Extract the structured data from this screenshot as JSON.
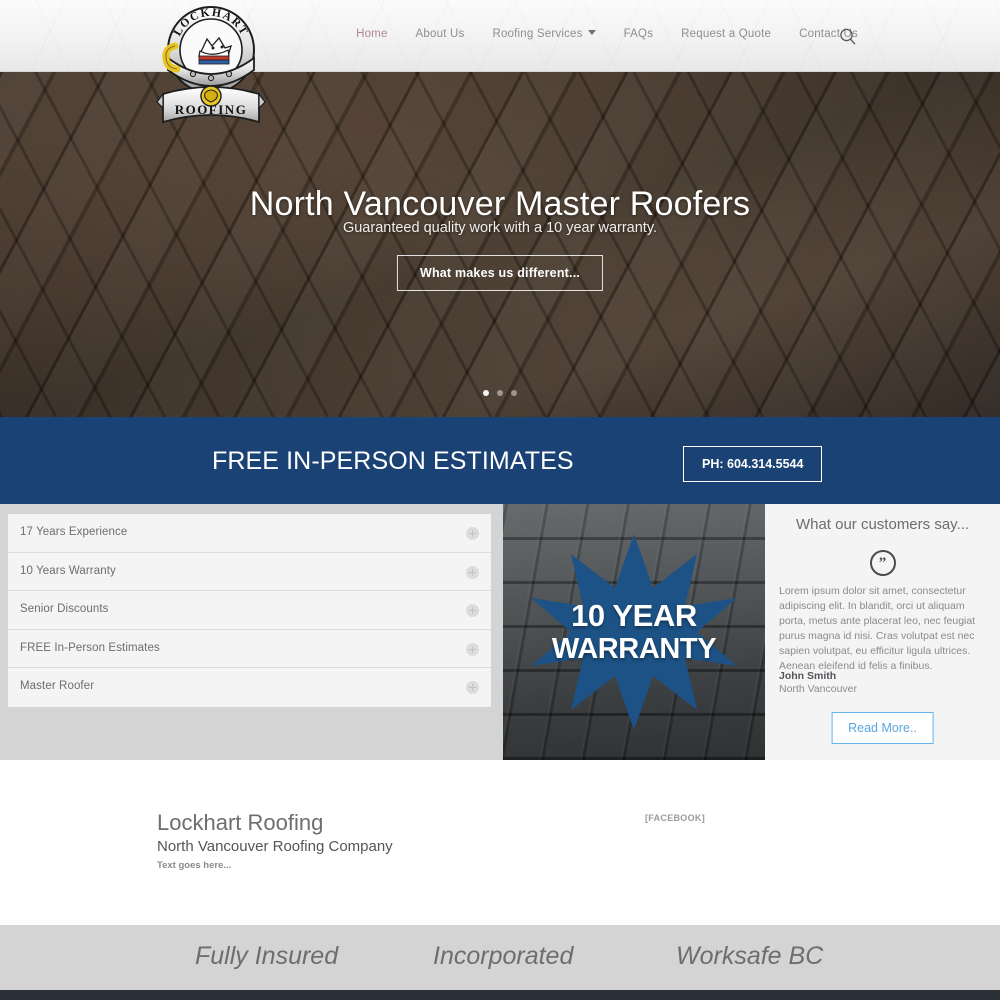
{
  "site": {
    "brand": "Lockhart Roofing",
    "logo_top_text": "LOCKHART",
    "logo_bottom_text": "ROOFING"
  },
  "colors": {
    "brand_blue": "#1a4274",
    "active_nav": "#b0868f",
    "nav_grey": "#8e8e92",
    "panel_grey": "#d4d4d4",
    "panel_light": "#f4f4f4",
    "link_blue": "#5aa7df",
    "footer_dark": "#2b3038"
  },
  "nav": {
    "items": [
      {
        "label": "Home",
        "active": true,
        "has_dropdown": false
      },
      {
        "label": "About Us",
        "active": false,
        "has_dropdown": false
      },
      {
        "label": "Roofing Services",
        "active": false,
        "has_dropdown": true
      },
      {
        "label": "FAQs",
        "active": false,
        "has_dropdown": false
      },
      {
        "label": "Request a Quote",
        "active": false,
        "has_dropdown": false
      },
      {
        "label": "Contact Us",
        "active": false,
        "has_dropdown": false
      }
    ],
    "search_icon": "search-icon"
  },
  "hero": {
    "title": "North Vancouver Master Roofers",
    "subtitle": "Guaranteed quality work with a 10 year warranty.",
    "cta_label": "What makes us different...",
    "slides_total": 3,
    "active_slide": 1
  },
  "estimates_band": {
    "heading": "FREE IN-PERSON ESTIMATES",
    "phone_label": "PH: 604.314.5544"
  },
  "features": {
    "items": [
      {
        "label": "17 Years Experience"
      },
      {
        "label": "10 Years Warranty"
      },
      {
        "label": "Senior Discounts"
      },
      {
        "label": "FREE In-Person Estimates"
      },
      {
        "label": "Master Roofer"
      }
    ],
    "expand_icon": "plus-circle-icon"
  },
  "warranty_badge": {
    "line1": "10 YEAR",
    "line2": "WARRANTY",
    "shape": "starburst"
  },
  "testimonial": {
    "title": "What our customers say...",
    "quote_icon": "quote-mark-icon",
    "body": "Lorem ipsum dolor sit amet, consectetur adipiscing elit. In blandit, orci ut aliquam porta, metus ante placerat leo, nec feugiat purus magna id nisi. Cras volutpat est nec sapien volutpat, eu efficitur ligula ultrices. Aenean eleifend id felis a finibus.",
    "author": "John Smith",
    "location": "North Vancouver",
    "cta_label": "Read More.."
  },
  "footer": {
    "title": "Lockhart Roofing",
    "subtitle": "North Vancouver Roofing Company",
    "text": "Text goes here...",
    "facebook_label": "[FACEBOOK]"
  },
  "credentials": {
    "items": [
      {
        "label": "Fully Insured"
      },
      {
        "label": "Incorporated"
      },
      {
        "label": "Worksafe BC"
      }
    ]
  }
}
